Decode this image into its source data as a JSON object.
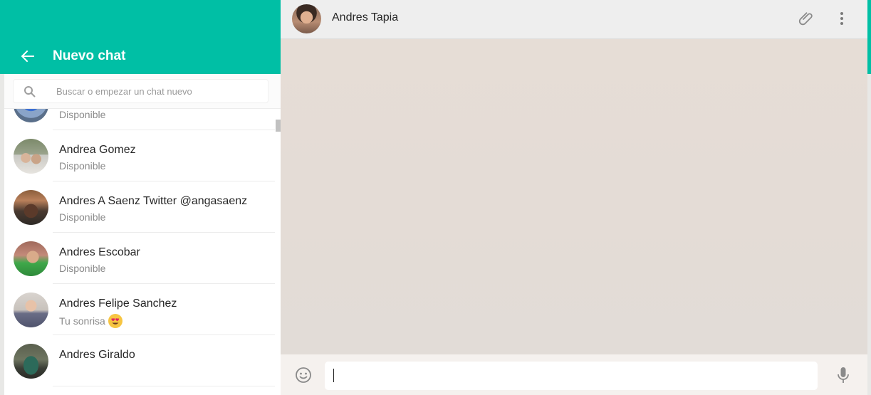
{
  "new_chat": {
    "title": "Nuevo chat",
    "search_placeholder": "Buscar o empezar un chat nuevo"
  },
  "contacts": [
    {
      "name": "",
      "status": "Disponible"
    },
    {
      "name": "Andrea Gomez",
      "status": "Disponible"
    },
    {
      "name": "Andres A Saenz Twitter @angasaenz",
      "status": "Disponible"
    },
    {
      "name": "Andres Escobar",
      "status": "Disponible"
    },
    {
      "name": "Andres Felipe Sanchez",
      "status": "Tu sonrisa"
    },
    {
      "name": "Andres Giraldo",
      "status": ""
    }
  ],
  "chat": {
    "contact_name": "Andres Tapia",
    "message_value": ""
  },
  "icons": {
    "back": "back-arrow-icon",
    "search": "search-icon",
    "attach": "paperclip-icon",
    "menu": "more-vertical-icon",
    "emoji": "smiley-icon",
    "mic": "microphone-icon",
    "status_emoji": "heart-eyes-emoji-icon"
  },
  "colors": {
    "accent": "#00bfa5",
    "chat_background": "#e5ddd5",
    "header_background": "#eeeeee"
  }
}
